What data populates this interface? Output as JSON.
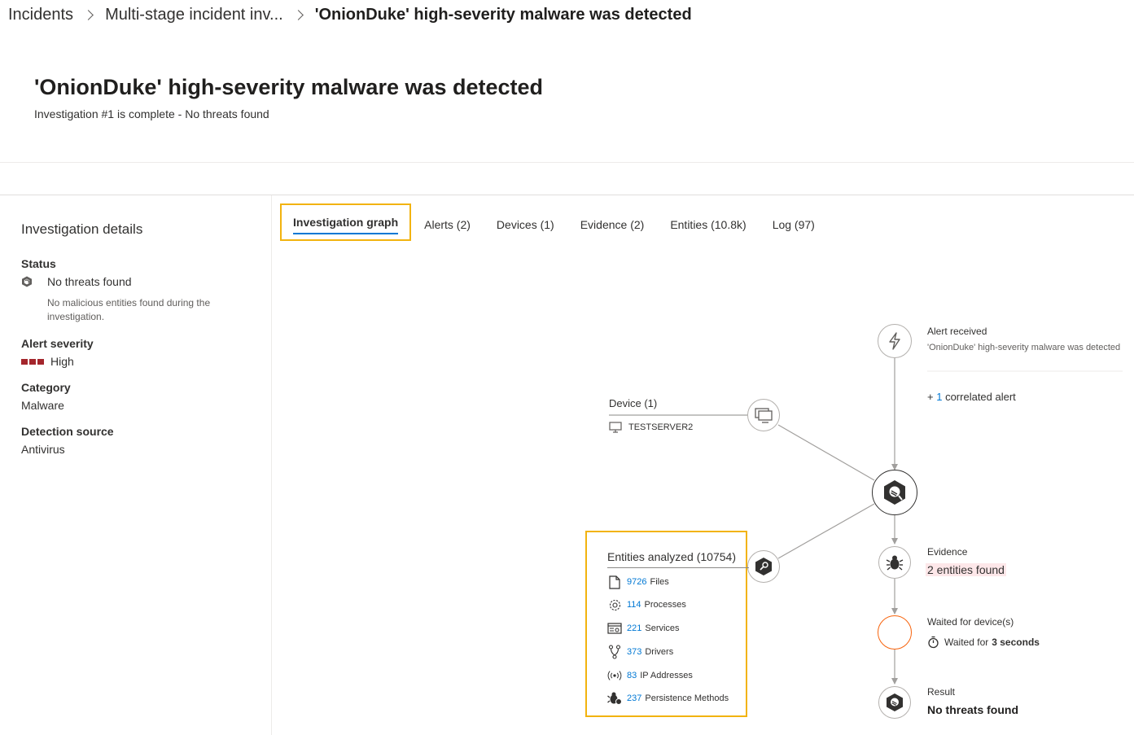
{
  "breadcrumb": {
    "items": [
      "Incidents",
      "Multi-stage incident inv...",
      "'OnionDuke' high-severity malware was detected"
    ]
  },
  "page": {
    "title": "'OnionDuke' high-severity malware was detected",
    "subtitle": "Investigation #1 is complete - No threats found"
  },
  "details": {
    "heading": "Investigation details",
    "status_label": "Status",
    "status_value": "No threats found",
    "status_note": "No malicious entities found during the investigation.",
    "severity_label": "Alert severity",
    "severity_value": "High",
    "category_label": "Category",
    "category_value": "Malware",
    "source_label": "Detection source",
    "source_value": "Antivirus"
  },
  "tabs": [
    {
      "label": "Investigation graph",
      "active": true
    },
    {
      "label": "Alerts  (2)"
    },
    {
      "label": "Devices  (1)"
    },
    {
      "label": "Evidence  (2)"
    },
    {
      "label": "Entities  (10.8k)"
    },
    {
      "label": "Log  (97)"
    }
  ],
  "graph": {
    "alert_title": "Alert received",
    "alert_desc": "'OnionDuke' high-severity malware was detected",
    "correlated_plus": "+",
    "correlated_count": "1",
    "correlated_text": "correlated alert",
    "device_title": "Device (1)",
    "device_name": "TESTSERVER2",
    "evidence_title": "Evidence",
    "evidence_value": "2 entities found",
    "waited_title": "Waited for device(s)",
    "waited_prefix": "Waited for",
    "waited_value": "3 seconds",
    "result_title": "Result",
    "result_value": "No threats found",
    "entities_title": "Entities analyzed (10754)",
    "entities": [
      {
        "icon": "file-icon",
        "count": "9726",
        "label": "Files"
      },
      {
        "icon": "gear-icon",
        "count": "114",
        "label": "Processes"
      },
      {
        "icon": "service-icon",
        "count": "221",
        "label": "Services"
      },
      {
        "icon": "driver-icon",
        "count": "373",
        "label": "Drivers"
      },
      {
        "icon": "ip-address-icon",
        "count": "83",
        "label": "IP Addresses"
      },
      {
        "icon": "persistence-icon",
        "count": "237",
        "label": "Persistence Methods"
      }
    ]
  },
  "colors": {
    "accent": "#0078d4",
    "highlight_border": "#f2b30f",
    "severity_high": "#a4262c",
    "waiting_ring": "#f7630c"
  }
}
